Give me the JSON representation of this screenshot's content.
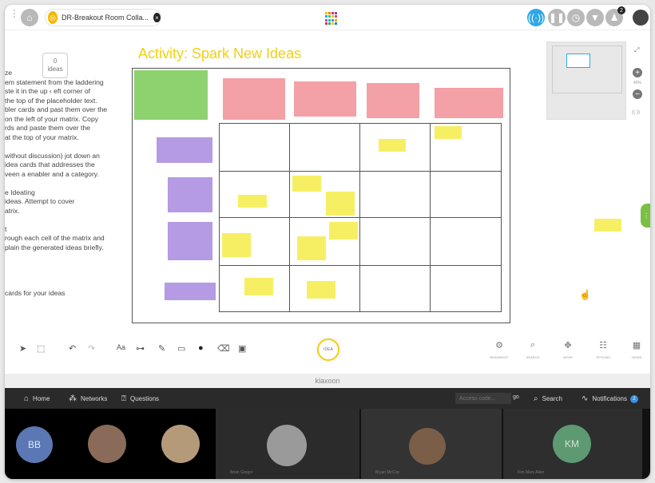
{
  "topbar": {
    "tab_label": "DR-Breakout Room Colla...",
    "right_badge": "2"
  },
  "workspace": {
    "idea_count": "0",
    "idea_label": "ideas",
    "activity_title": "Activity: Spark New Ideas",
    "instructions": [
      "ze",
      "em statement from the laddering",
      "ste it in the up  ‹  eft corner of",
      " the top of the placeholder text.",
      "bler cards and past them over the",
      " on the left of your matrix. Copy",
      "rds and paste them over the",
      " at the top of your matrix.",
      "",
      " without discussion) jot down an",
      "idea cards that addresses the",
      "veen a enabler and a category.",
      "",
      "e Ideating",
      " ideas. Attempt to cover",
      "atrix.",
      "",
      "t",
      "rough each cell of the matrix and",
      "plain the generated ideas briefly.",
      "",
      "",
      "",
      "",
      " cards for your ideas"
    ],
    "zoom_level": "40%"
  },
  "toolbar": {
    "idea_button": "IDEA",
    "right_tools": [
      {
        "icon": "gear",
        "label": "BRAINSHOT"
      },
      {
        "icon": "search",
        "label": "SEARCH"
      },
      {
        "icon": "move",
        "label": "MOVE"
      },
      {
        "icon": "options",
        "label": "OPTIONS"
      },
      {
        "icon": "views",
        "label": "VIEWS"
      }
    ]
  },
  "brand": "klaxoon",
  "nav": {
    "home": "Home",
    "networks": "Networks",
    "questions": "Questions",
    "access_placeholder": "Access code...",
    "go": "go",
    "search": "Search",
    "notifications": "Notifications",
    "notifications_count": "2"
  },
  "videos": [
    {
      "initials": "BB",
      "name": ""
    },
    {
      "initials": "",
      "name": ""
    },
    {
      "initials": "",
      "name": ""
    },
    {
      "initials": "",
      "name": "Brian Gregor"
    },
    {
      "initials": "",
      "name": "Bryan McCoy"
    },
    {
      "initials": "KM",
      "name": "Kim Mars Allen"
    }
  ]
}
